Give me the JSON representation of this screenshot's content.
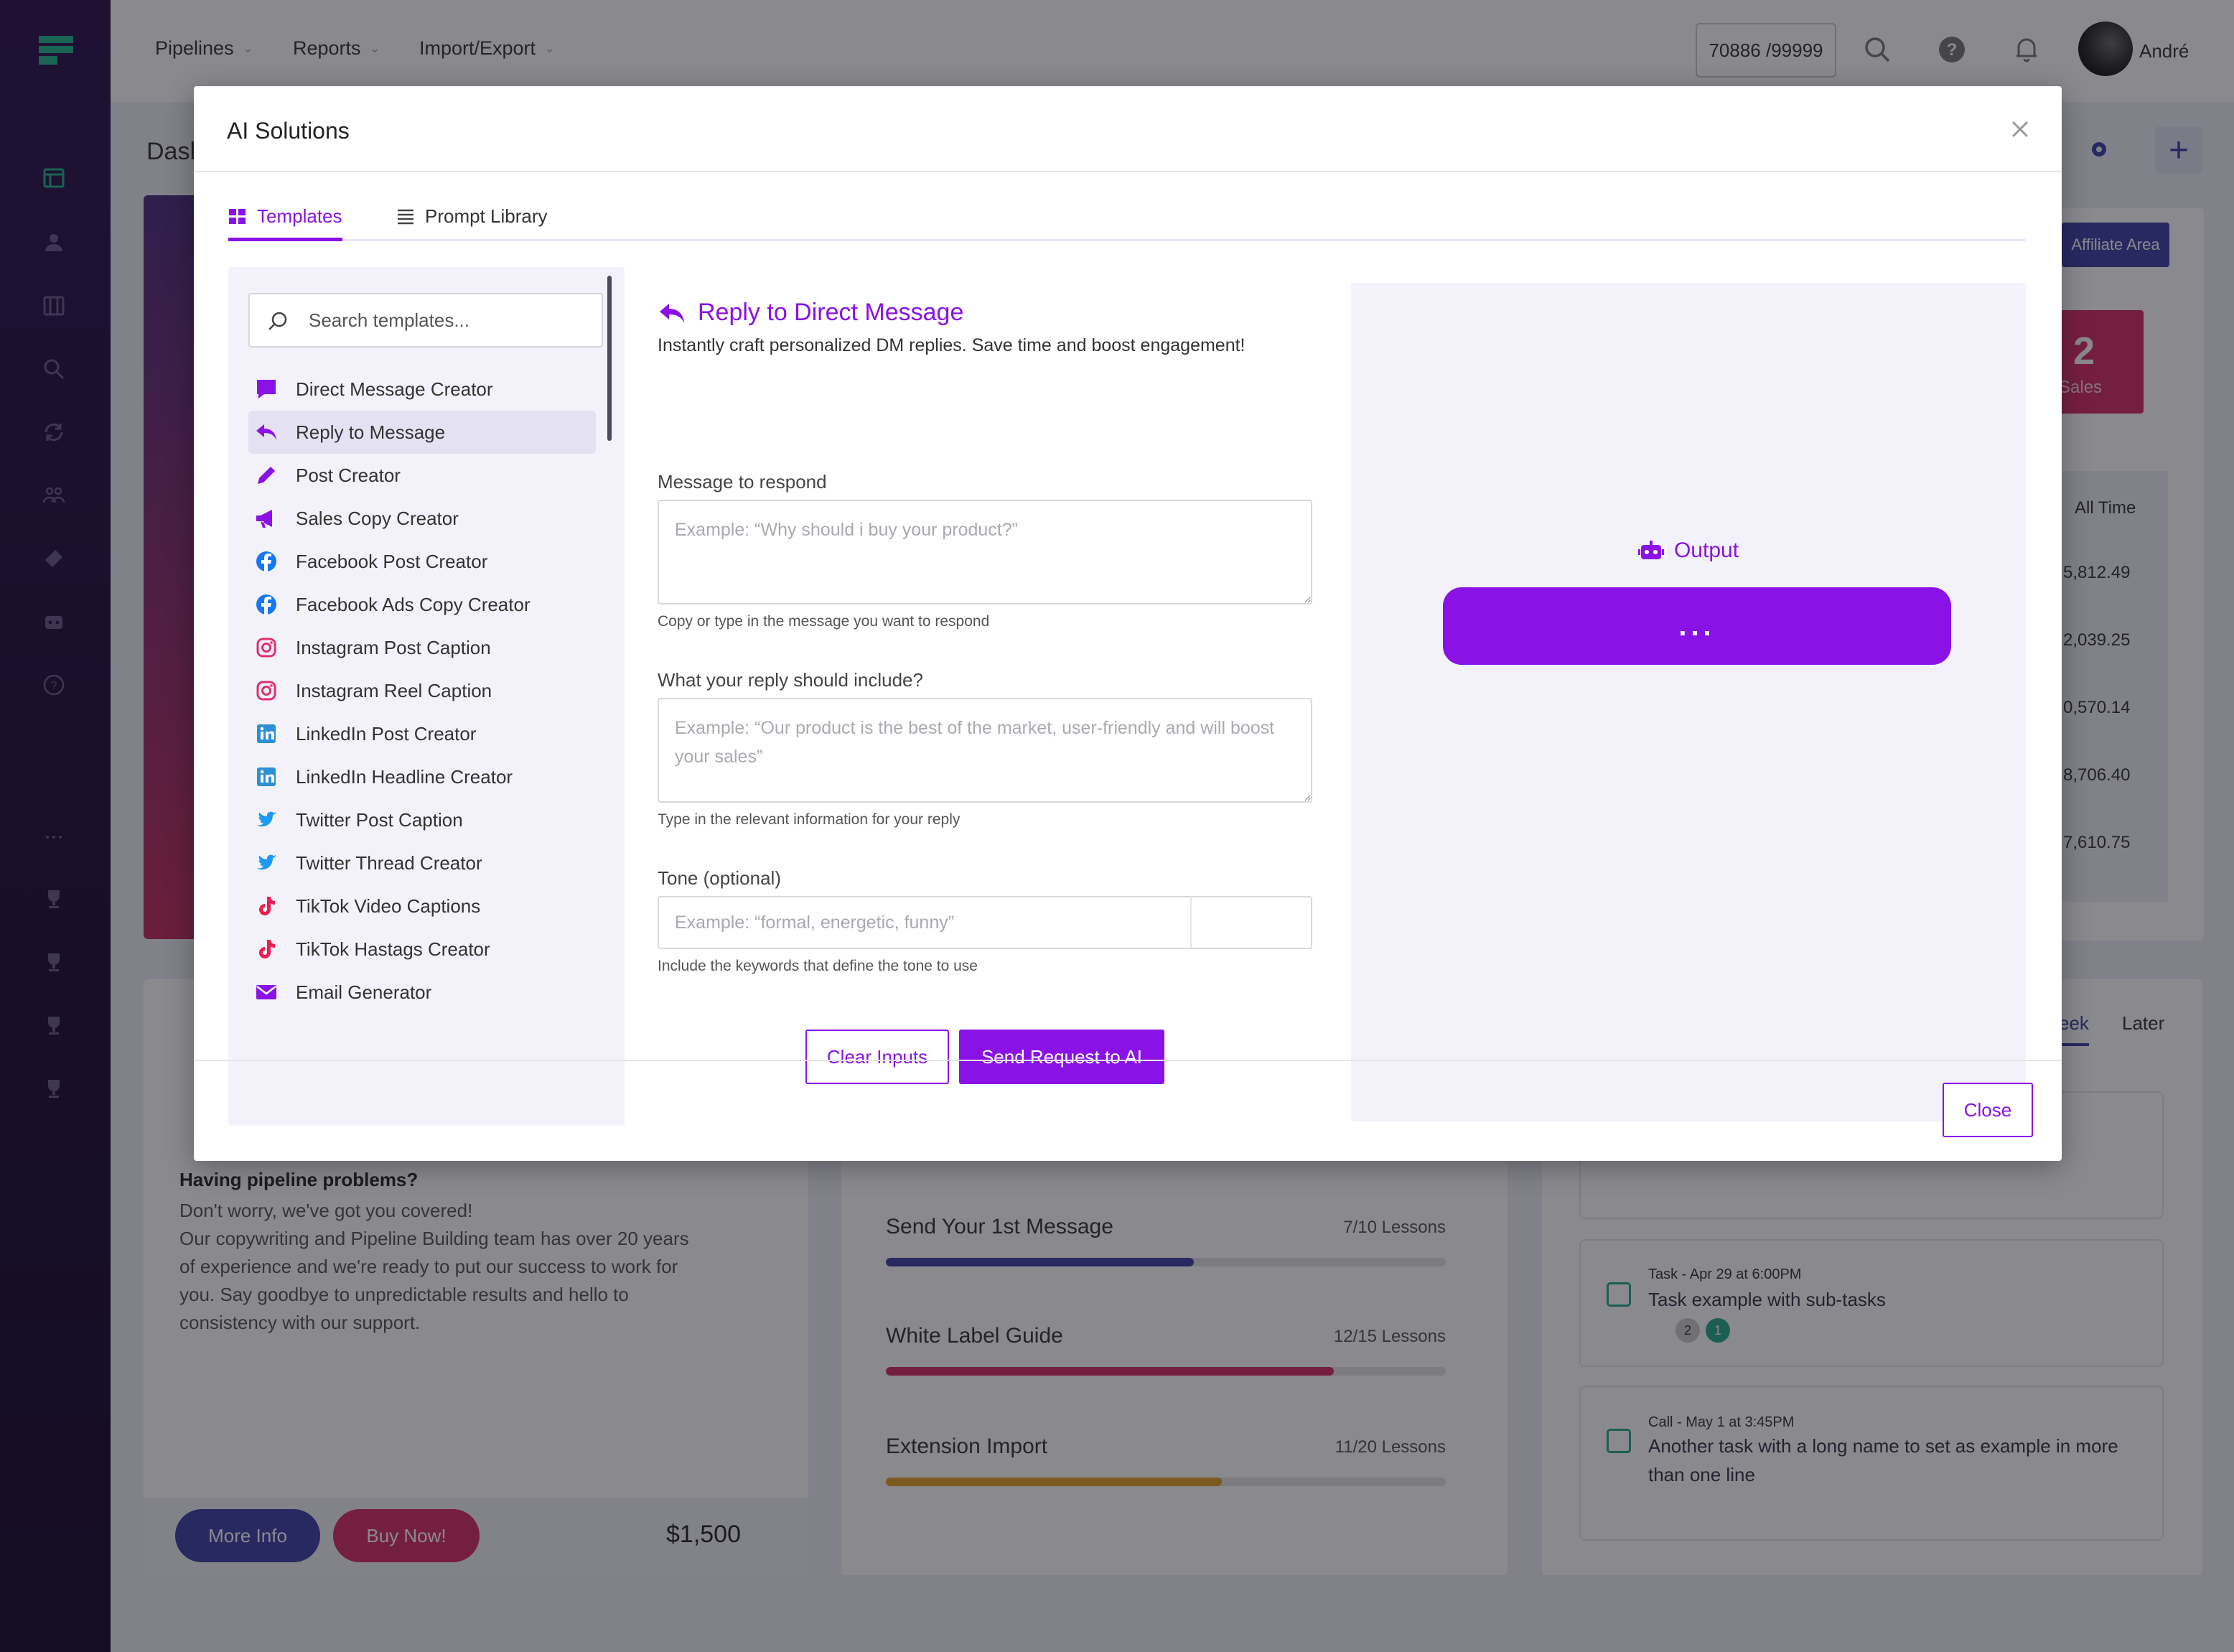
{
  "topbar": {
    "nav": [
      "Pipelines",
      "Reports",
      "Import/Export"
    ],
    "counter": "70886 /99999",
    "user_name": "André"
  },
  "background": {
    "page_title": "Dash",
    "affiliate_label": "Affiliate Area",
    "sales_value": "2",
    "sales_label": "Sales",
    "all_time_label": "All Time",
    "amounts": [
      "5,812.49",
      "2,039.25",
      "0,570.14",
      "8,706.40",
      "7,610.75"
    ],
    "week_tab": "eek",
    "later_tab": "Later",
    "promo": {
      "title": "Having pipeline problems?",
      "text": "Don't worry, we've got you covered!\nOur copywriting and Pipeline Building team has over 20 years of experience and we're ready to put our success to work for you. Say goodbye to unpredictable results and hello to consistency with our support.",
      "more_info": "More Info",
      "buy_now": "Buy Now!",
      "price": "$1,500"
    },
    "courses": [
      {
        "name": "Send Your 1st Message",
        "lessons": "7/10 Lessons",
        "progress": 0.55,
        "color": "#3d3fa5"
      },
      {
        "name": "White Label Guide",
        "lessons": "12/15 Lessons",
        "progress": 0.8,
        "color": "#d62a5f"
      },
      {
        "name": "Extension Import",
        "lessons": "11/20 Lessons",
        "progress": 0.6,
        "color": "#e2a123"
      }
    ],
    "tasks": [
      {
        "meta": "Task - Apr 29 at 6:00PM",
        "title": "Task example with sub-tasks",
        "badges": [
          "2",
          "1"
        ]
      },
      {
        "meta": "Call - May 1 at 3:45PM",
        "title": "Another task with a long name to set as example in more than one line"
      }
    ]
  },
  "modal": {
    "title": "AI Solutions",
    "tabs": [
      {
        "label": "Templates",
        "icon": "grid-icon"
      },
      {
        "label": "Prompt Library",
        "icon": "list-icon"
      }
    ],
    "search_placeholder": "Search templates...",
    "templates": [
      {
        "label": "Direct Message Creator",
        "icon": "chat-icon",
        "color": "#8a12e6"
      },
      {
        "label": "Reply to Message",
        "icon": "reply-icon",
        "color": "#8a12e6"
      },
      {
        "label": "Post Creator",
        "icon": "pencil-icon",
        "color": "#8a12e6"
      },
      {
        "label": "Sales Copy Creator",
        "icon": "megaphone-icon",
        "color": "#8a12e6"
      },
      {
        "label": "Facebook Post Creator",
        "icon": "facebook-icon",
        "color": "#1877f2"
      },
      {
        "label": "Facebook Ads Copy Creator",
        "icon": "facebook-icon",
        "color": "#1877f2"
      },
      {
        "label": "Instagram Post Caption",
        "icon": "instagram-icon",
        "color": "#e1306c"
      },
      {
        "label": "Instagram Reel Caption",
        "icon": "instagram-icon",
        "color": "#e1306c"
      },
      {
        "label": "LinkedIn Post Creator",
        "icon": "linkedin-icon",
        "color": "#2d8fd5"
      },
      {
        "label": "LinkedIn Headline Creator",
        "icon": "linkedin-icon",
        "color": "#2d8fd5"
      },
      {
        "label": "Twitter Post Caption",
        "icon": "twitter-icon",
        "color": "#1d9bf0"
      },
      {
        "label": "Twitter Thread Creator",
        "icon": "twitter-icon",
        "color": "#1d9bf0"
      },
      {
        "label": "TikTok Video Captions",
        "icon": "tiktok-icon",
        "color": "#ee1d52"
      },
      {
        "label": "TikTok Hastags Creator",
        "icon": "tiktok-icon",
        "color": "#ee1d52"
      },
      {
        "label": "Email Generator",
        "icon": "envelope-icon",
        "color": "#8a12e6"
      }
    ],
    "selected_template_index": 1,
    "form": {
      "heading": "Reply to Direct Message",
      "description": "Instantly craft personalized DM replies. Save time and boost engagement!",
      "field1_label": "Message to respond",
      "field1_placeholder": "Example: “Why should i buy your product?”",
      "field1_hint": "Copy or type in the message you want to respond",
      "field2_label": "What your reply should include?",
      "field2_placeholder": "Example: “Our product is the best of the market, user-friendly and will boost your sales”",
      "field2_hint": "Type in the relevant information for your reply",
      "field3_label": "Tone (optional)",
      "field3_placeholder": "Example: “formal, energetic, funny”",
      "field3_hint": "Include the keywords that define the tone to use",
      "clear_label": "Clear Inputs",
      "send_label": "Send Request to AI"
    },
    "output": {
      "label": "Output",
      "bar_text": "..."
    },
    "close_label": "Close"
  },
  "colors": {
    "accent": "#8a12e6",
    "sidebar": "#2c0f49"
  }
}
